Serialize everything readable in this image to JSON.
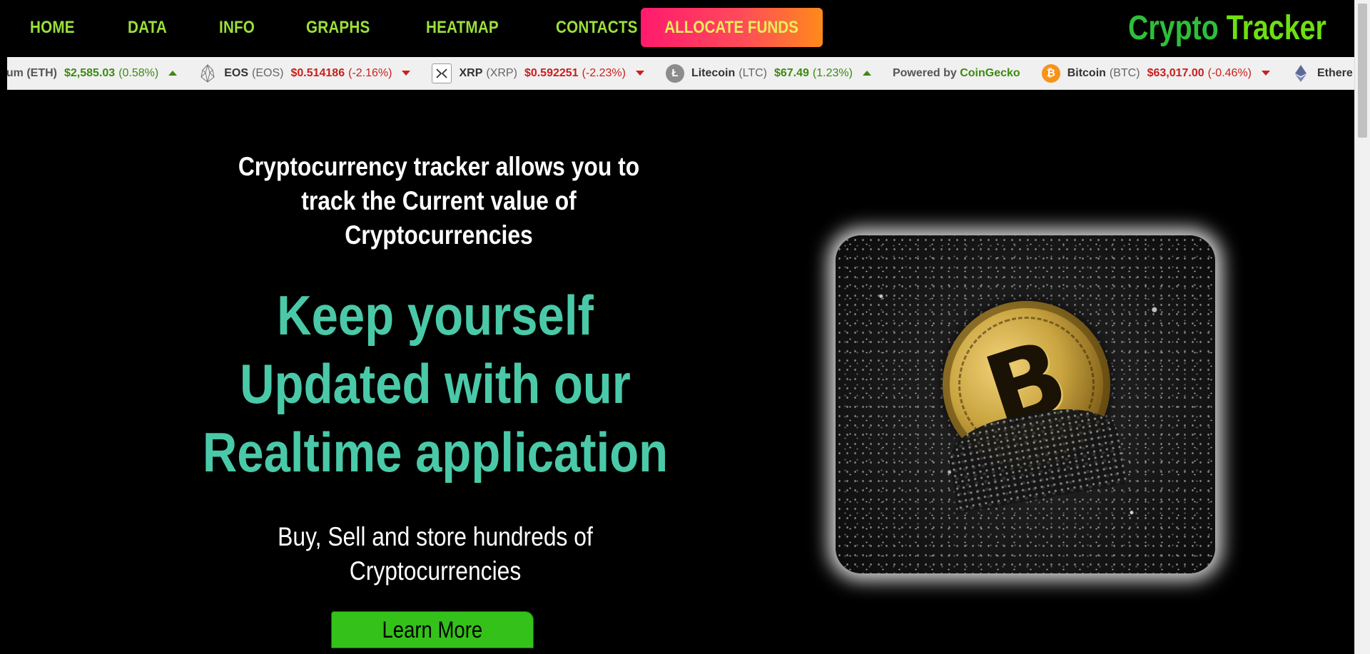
{
  "nav": {
    "links": [
      "HOME",
      "DATA",
      "INFO",
      "GRAPHS",
      "HEATMAP",
      "CONTACTS"
    ],
    "allocate_label": "ALLOCATE FUNDS",
    "brand_part1": "Crypto",
    "brand_part2": "Tracker"
  },
  "ticker": {
    "items": [
      {
        "name": "",
        "symbol": "eum (ETH)",
        "price": "$2,585.03",
        "change": "(0.58%)",
        "direction": "up",
        "icon": "none"
      },
      {
        "name": "EOS",
        "symbol": "(EOS)",
        "price": "$0.514186",
        "change": "(-2.16%)",
        "direction": "down",
        "icon": "eos-icon"
      },
      {
        "name": "XRP",
        "symbol": "(XRP)",
        "price": "$0.592251",
        "change": "(-2.23%)",
        "direction": "down",
        "icon": "xrp-icon"
      },
      {
        "name": "Litecoin",
        "symbol": "(LTC)",
        "price": "$67.49",
        "change": "(1.23%)",
        "direction": "up",
        "icon": "litecoin-icon"
      }
    ],
    "powered_by": "Powered by",
    "powered_brand": "CoinGecko",
    "items_after": [
      {
        "name": "Bitcoin",
        "symbol": "(BTC)",
        "price": "$63,017.00",
        "change": "(-0.46%)",
        "direction": "down",
        "icon": "bitcoin-icon"
      },
      {
        "name": "Ethere",
        "symbol": "",
        "price": "",
        "change": "",
        "direction": "",
        "icon": "ethereum-icon"
      }
    ]
  },
  "hero": {
    "intro": "Cryptocurrency tracker allows you to track the Current value of Cryptocurrencies",
    "headline_1": "Keep yourself",
    "headline_2": "Updated with our",
    "headline_3": "Realtime application",
    "sub": "Buy, Sell and store hundreds of Cryptocurrencies",
    "cta": "Learn More"
  },
  "colors": {
    "nav_link": "#9be03a",
    "headline": "#4ac9a8",
    "cta": "#34c21a",
    "price_up": "#3d8a11",
    "price_down": "#c8201e"
  }
}
